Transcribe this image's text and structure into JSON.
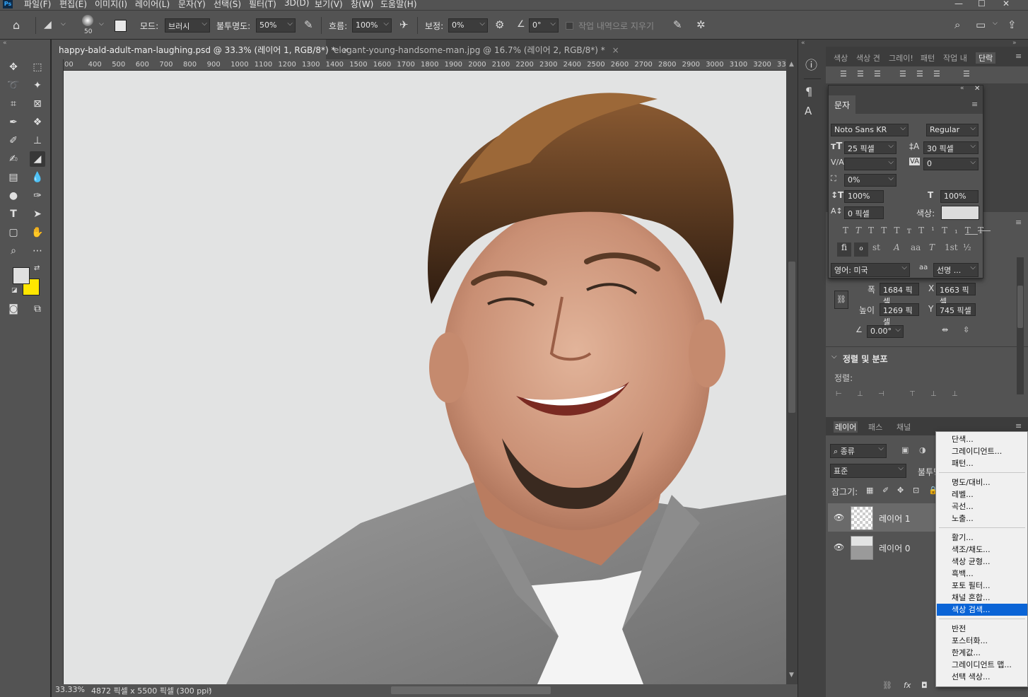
{
  "app": {
    "logo": "Ps"
  },
  "menu": [
    "파일(F)",
    "편집(E)",
    "이미지(I)",
    "레이어(L)",
    "문자(Y)",
    "선택(S)",
    "필터(T)",
    "3D(D)",
    "보기(V)",
    "창(W)",
    "도움말(H)"
  ],
  "options": {
    "brush_size": "50",
    "mode_label": "모드:",
    "mode_value": "브러시",
    "opacity_label": "불투명도:",
    "opacity_value": "50%",
    "flow_label": "흐름:",
    "flow_value": "100%",
    "smoothing_label": "보정:",
    "smoothing_value": "0%",
    "angle_value": "0°",
    "erase_history_label": "작업 내역으로 지우기"
  },
  "tabs": [
    {
      "title": "happy-bald-adult-man-laughing.psd @ 33.3% (레이어 1, RGB/8*) *",
      "close": "×"
    },
    {
      "title": "elegant-young-handsome-man.jpg @ 16.7% (레이어 2, RGB/8*) *",
      "close": "×"
    }
  ],
  "ruler": [
    "00",
    "400",
    "500",
    "600",
    "700",
    "800",
    "900",
    "1000",
    "1100",
    "1200",
    "1300",
    "1400",
    "1500",
    "1600",
    "1700",
    "1800",
    "1900",
    "2000",
    "2100",
    "2200",
    "2300",
    "2400",
    "2500",
    "2600",
    "2700",
    "2800",
    "2900",
    "3000",
    "3100",
    "3200",
    "3300"
  ],
  "status": {
    "zoom": "33.33%",
    "doc_info": "4872 픽셀 x 5500 픽셀 (300 ppi)",
    "arrow": "›"
  },
  "top_panel_tabs": [
    "색상",
    "색상 견",
    "그레이!",
    "패턴",
    "작업 내",
    "단락"
  ],
  "character": {
    "title": "문자",
    "font_family": "Noto Sans KR",
    "font_style": "Regular",
    "font_size": "25 픽셀",
    "leading": "30 픽셀",
    "kerning": "",
    "tracking": "0",
    "tsume": "0%",
    "vertical_scale": "100%",
    "horizontal_scale": "100%",
    "baseline_shift": "0 픽셀",
    "color_label": "색상:",
    "color_swatch": "#dcdcdc",
    "language": "영어: 미국",
    "antialias_icon": "aa",
    "antialias": "선명 ..."
  },
  "properties": {
    "width_label": "폭",
    "width_value": "1684 픽셀",
    "x_label": "X",
    "x_value": "1663 픽셀",
    "height_label": "높이",
    "height_value": "1269 픽셀",
    "y_label": "Y",
    "y_value": "745 픽셀",
    "angle_value": "0.00°",
    "align_section": "정렬 및 분포",
    "align_label": "정렬:"
  },
  "layers_panel": {
    "tabs": [
      "레이어",
      "패스",
      "채널"
    ],
    "filter_kind": "종류",
    "blend_mode": "표준",
    "opacity_label": "불투명",
    "lock_label": "잠그기:",
    "layers": [
      {
        "name": "레이어 1",
        "selected": true
      },
      {
        "name": "레이어 0",
        "selected": false
      }
    ]
  },
  "context_menu": {
    "groups": [
      [
        "단색...",
        "그레이디언트...",
        "패턴..."
      ],
      [
        "명도/대비...",
        "레벨...",
        "곡선...",
        "노출..."
      ],
      [
        "활기...",
        "색조/채도...",
        "색상 균형...",
        "흑백...",
        "포토 필터...",
        "채널 혼합...",
        "색상 검색..."
      ],
      [
        "반전",
        "포스터화...",
        "한계값...",
        "그레이디언트 맵...",
        "선택 색상..."
      ]
    ],
    "selected": "색상 검색..."
  },
  "colors": {
    "foreground": "#e0e0e0",
    "background": "#ffe600",
    "accent": "#0a64d6",
    "canvas_bg": "#e2e3e3"
  }
}
